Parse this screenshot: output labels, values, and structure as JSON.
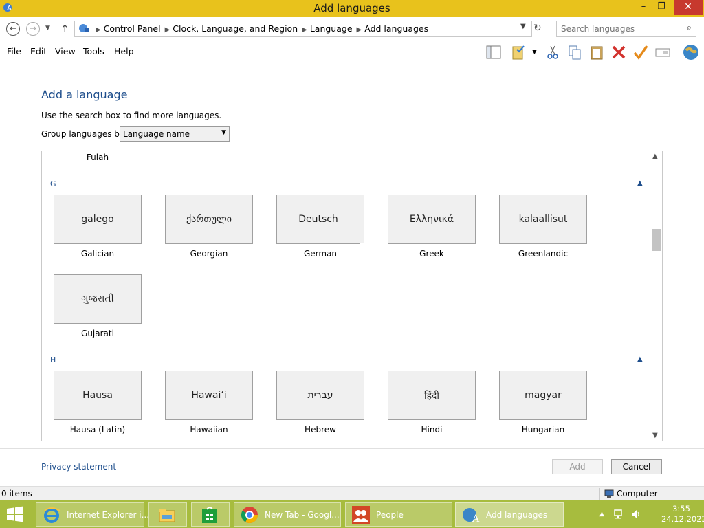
{
  "window": {
    "title": "Add languages",
    "min_glyph": "–",
    "max_glyph": "❐",
    "close_glyph": "✕"
  },
  "address": {
    "breadcrumbs": [
      "Control Panel",
      "Clock, Language, and Region",
      "Language",
      "Add languages"
    ],
    "search_placeholder": "Search languages"
  },
  "menu": {
    "file": "File",
    "edit": "Edit",
    "view": "View",
    "tools": "Tools",
    "help": "Help"
  },
  "toolbar_icons": [
    "layout-pane-icon",
    "properties-icon",
    "cut-icon",
    "copy-icon",
    "paste-icon",
    "delete-icon",
    "check-icon",
    "rename-icon",
    "globe-icon"
  ],
  "main": {
    "heading": "Add a language",
    "hint": "Use the search box to find more languages.",
    "group_by_label": "Group languages by:",
    "group_by_value": "Language name"
  },
  "languages": {
    "top_partial": "Fulah",
    "groups": [
      {
        "letter": "G",
        "items": [
          {
            "native": "galego",
            "name": "Galician"
          },
          {
            "native": "ქართული",
            "name": "Georgian"
          },
          {
            "native": "Deutsch",
            "name": "German"
          },
          {
            "native": "Ελληνικά",
            "name": "Greek"
          },
          {
            "native": "kalaallisut",
            "name": "Greenlandic"
          },
          {
            "native": "ગુજરાતી",
            "name": "Gujarati"
          }
        ]
      },
      {
        "letter": "H",
        "items": [
          {
            "native": "Hausa",
            "name": "Hausa (Latin)"
          },
          {
            "native": "Hawaiʻi",
            "name": "Hawaiian"
          },
          {
            "native": "עברית",
            "name": "Hebrew"
          },
          {
            "native": "हिंदी",
            "name": "Hindi"
          },
          {
            "native": "magyar",
            "name": "Hungarian"
          }
        ]
      }
    ]
  },
  "footer": {
    "privacy": "Privacy statement",
    "add": "Add",
    "cancel": "Cancel"
  },
  "status": {
    "items": "0 items",
    "location": "Computer"
  },
  "taskbar": {
    "items": [
      {
        "label": "Internet Explorer i...",
        "icon": "internet-explorer-icon"
      },
      {
        "label": "",
        "icon": "file-explorer-icon"
      },
      {
        "label": "",
        "icon": "store-icon"
      },
      {
        "label": "New Tab - Googl...",
        "icon": "chrome-icon"
      },
      {
        "label": "People",
        "icon": "people-icon"
      },
      {
        "label": "Add languages",
        "icon": "language-icon"
      }
    ],
    "time": "3:55",
    "date": "24.12.2022"
  },
  "colors": {
    "titlebar": "#e8c21c",
    "taskbar": "#a7bc3e",
    "link": "#1e4e8c",
    "close": "#c7392e"
  }
}
